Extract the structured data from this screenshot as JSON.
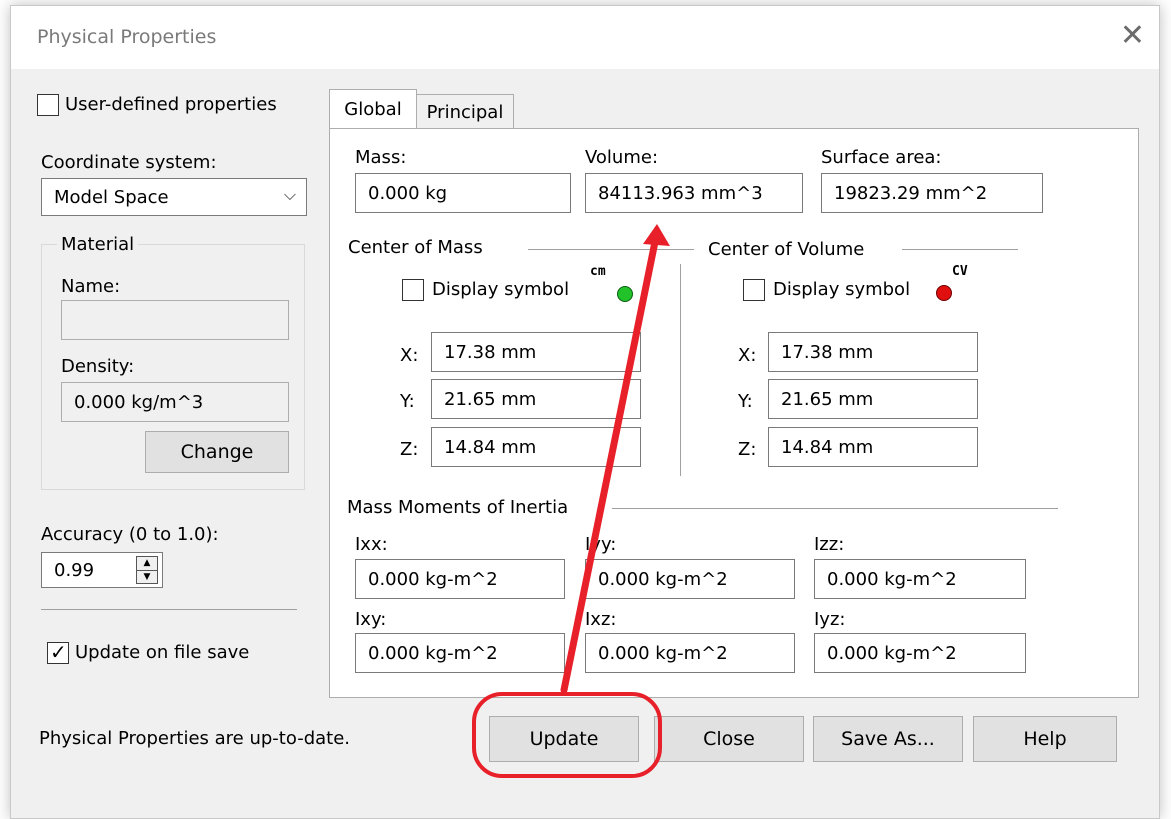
{
  "dialog": {
    "title": "Physical Properties"
  },
  "left": {
    "user_defined_label": "User-defined properties",
    "coord_label": "Coordinate system:",
    "coord_value": "Model Space",
    "material": {
      "group_label": "Material",
      "name_label": "Name:",
      "name_value": "",
      "density_label": "Density:",
      "density_value": "0.000 kg/m^3",
      "change_label": "Change"
    },
    "accuracy_label": "Accuracy (0 to 1.0):",
    "accuracy_value": "0.99",
    "update_on_save_label": "Update on file save",
    "status_text": "Physical Properties are up-to-date."
  },
  "tabs": {
    "global": "Global",
    "principal": "Principal"
  },
  "global": {
    "mass_label": "Mass:",
    "mass_value": "0.000 kg",
    "volume_label": "Volume:",
    "volume_value": "84113.963 mm^3",
    "surface_label": "Surface area:",
    "surface_value": "19823.29 mm^2",
    "com": {
      "title": "Center of Mass",
      "display_label": "Display symbol",
      "symbol_text": "cm",
      "x_label": "X:",
      "x_value": "17.38 mm",
      "y_label": "Y:",
      "y_value": "21.65 mm",
      "z_label": "Z:",
      "z_value": "14.84 mm"
    },
    "cov": {
      "title": "Center of Volume",
      "display_label": "Display symbol",
      "symbol_text": "CV",
      "x_label": "X:",
      "x_value": "17.38 mm",
      "y_label": "Y:",
      "y_value": "21.65 mm",
      "z_label": "Z:",
      "z_value": "14.84 mm"
    },
    "inertia": {
      "title": "Mass Moments of Inertia",
      "ixx_label": "Ixx:",
      "ixx_value": "0.000 kg-m^2",
      "iyy_label": "Iyy:",
      "iyy_value": "0.000 kg-m^2",
      "izz_label": "Izz:",
      "izz_value": "0.000 kg-m^2",
      "ixy_label": "Ixy:",
      "ixy_value": "0.000 kg-m^2",
      "ixz_label": "Ixz:",
      "ixz_value": "0.000 kg-m^2",
      "iyz_label": "Iyz:",
      "iyz_value": "0.000 kg-m^2"
    }
  },
  "buttons": {
    "update": "Update",
    "close": "Close",
    "save_as": "Save As...",
    "help": "Help"
  },
  "colors": {
    "annotation_red": "#e8202a",
    "cm_symbol": "#22c22a",
    "cv_symbol": "#e01010"
  }
}
